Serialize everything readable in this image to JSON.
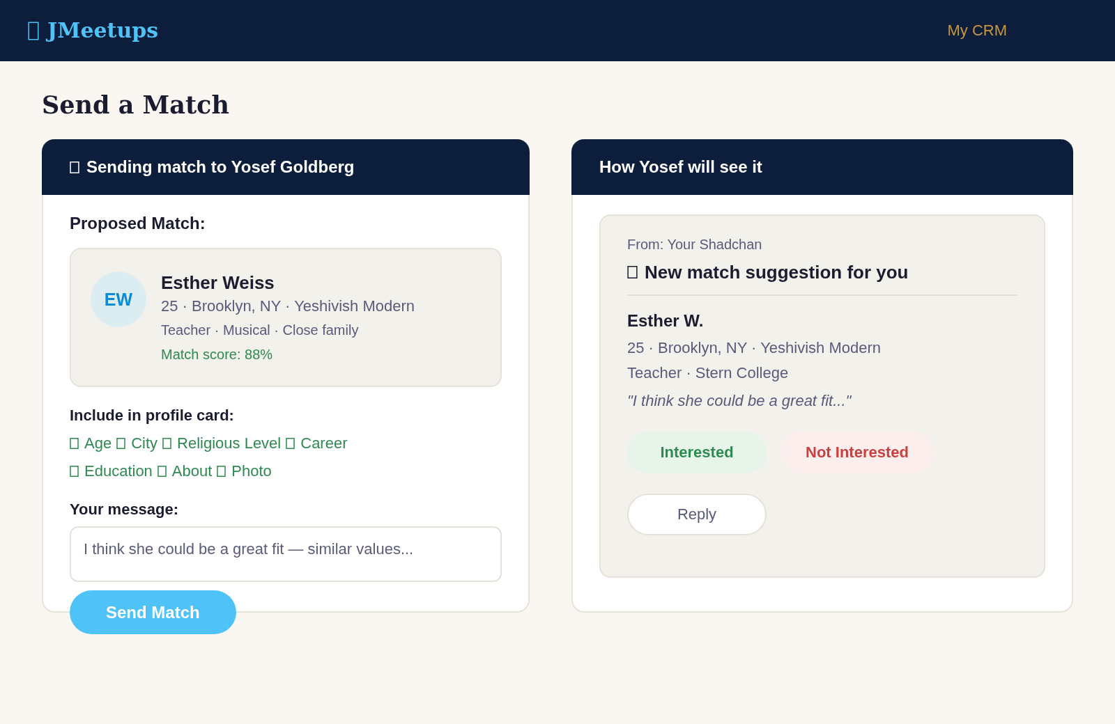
{
  "top_bar": {
    "logo": "JMeetups",
    "nav_link": "My CRM"
  },
  "page_title": "Send a Match",
  "send_panel": {
    "title": "Sending match to Yosef Goldberg",
    "section_label": "Proposed Match:",
    "candidate": {
      "initials": "EW",
      "name": "Esther Weiss",
      "details": "25 · Brooklyn, NY · Yeshivish Modern",
      "traits": "Teacher · Musical · Close family",
      "match_score": "Match score: 88%"
    },
    "include_label": "Include in profile card:",
    "include_options": [
      {
        "label": "Age",
        "checked": true
      },
      {
        "label": "City",
        "checked": true
      },
      {
        "label": "Religious Level",
        "checked": true
      },
      {
        "label": "Career",
        "checked": true
      },
      {
        "label": "Education",
        "checked": true
      },
      {
        "label": "About",
        "checked": true
      },
      {
        "label": "Photo",
        "checked": true
      }
    ],
    "message_label": "Your message:",
    "message": "I think she could be a great fit — similar values...",
    "send_button": "Send Match"
  },
  "preview_panel": {
    "title": "How Yosef will see it",
    "from": "From: Your Shadchan",
    "headline": "New match suggestion for you",
    "name": "Esther W.",
    "details": "25 · Brooklyn, NY · Yeshivish Modern",
    "education": "Teacher · Stern College",
    "quote": "\"I think she could be a great fit...\"",
    "buttons": [
      {
        "label": "Interested",
        "kind": "accept"
      },
      {
        "label": "Not Interested",
        "kind": "decline"
      },
      {
        "label": "Reply",
        "kind": "reply"
      }
    ]
  }
}
